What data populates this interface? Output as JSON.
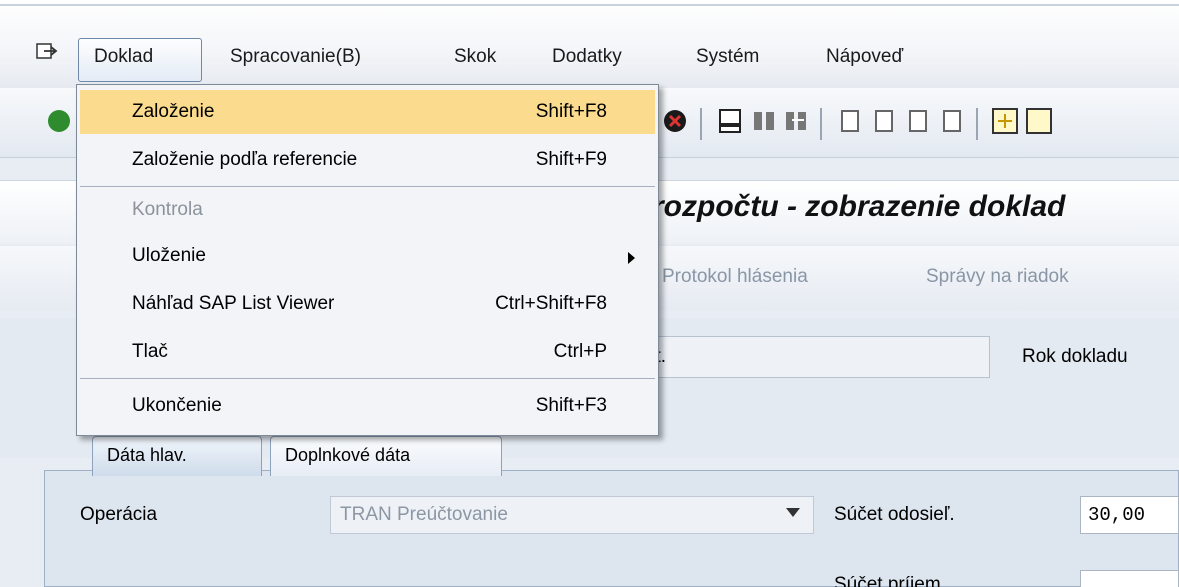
{
  "menubar": {
    "items": [
      {
        "label": "Doklad"
      },
      {
        "label": "Spracovanie(B)"
      },
      {
        "label": "Skok"
      },
      {
        "label": "Dodatky"
      },
      {
        "label": "Systém"
      },
      {
        "label": "Nápoveď"
      }
    ]
  },
  "dropdown": {
    "items": [
      {
        "label": "Založenie",
        "shortcut": "Shift+F8"
      },
      {
        "label": "Založenie podľa referencie",
        "shortcut": "Shift+F9"
      },
      {
        "label": "Kontrola",
        "shortcut": ""
      },
      {
        "label": "Uloženie",
        "shortcut": ""
      },
      {
        "label": "Náhľad SAP List Viewer",
        "shortcut": "Ctrl+Shift+F8"
      },
      {
        "label": "Tlač",
        "shortcut": "Ctrl+P"
      },
      {
        "label": "Ukončenie",
        "shortcut": "Shift+F3"
      }
    ]
  },
  "title": "rozpočtu - zobrazenie doklad",
  "app_toolbar": {
    "protocol": "Protokol hlásenia",
    "messages": "Správy na riadok"
  },
  "header_fields": {
    "doc_no_value": "čt.",
    "year_label": "Rok dokladu"
  },
  "tabs": [
    {
      "label": "Dáta hlav."
    },
    {
      "label": "Doplnkové dáta"
    }
  ],
  "form": {
    "operation_label": "Operácia",
    "operation_value": "TRAN Preúčtovanie",
    "sum_sender_label": "Súčet odosieľ.",
    "sum_sender_value": "30,00",
    "sum_receiver_label": "Súčet príjem."
  }
}
